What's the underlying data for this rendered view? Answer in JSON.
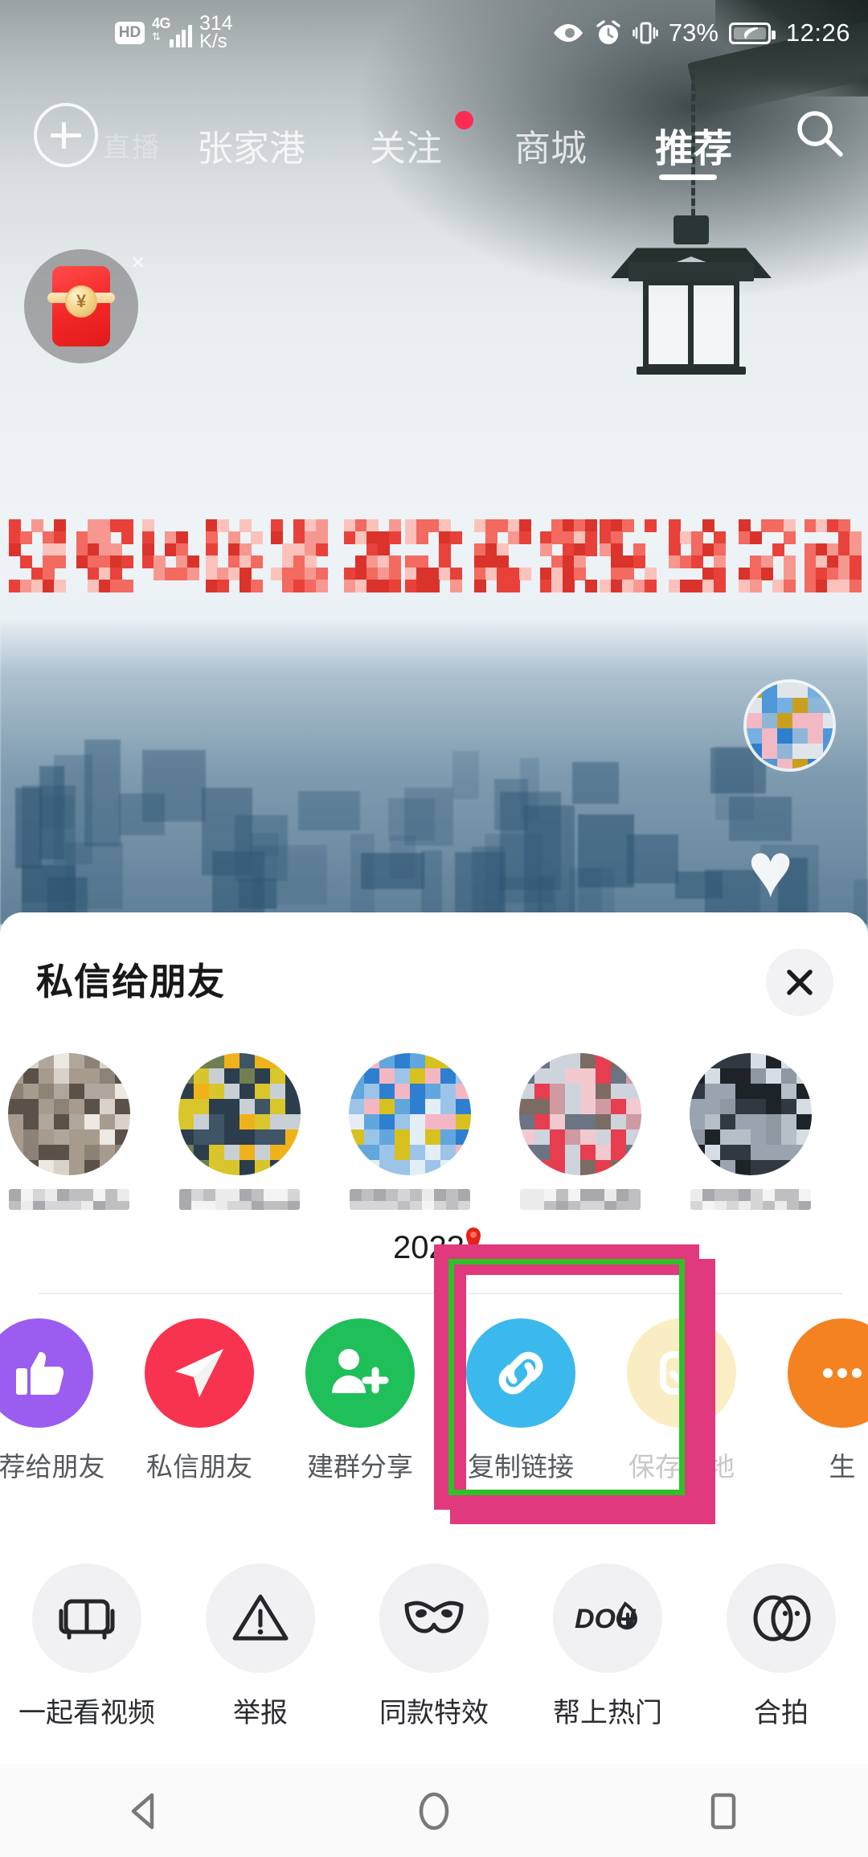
{
  "status_bar": {
    "hd": "HD",
    "network": "4G",
    "speed_value": "314",
    "speed_unit": "K/s",
    "battery_percent": "73%",
    "clock": "12:26",
    "icons": [
      "eye-icon",
      "alarm-clock-icon",
      "vibrate-icon",
      "battery-saver-icon"
    ]
  },
  "top_nav": {
    "add_button": "+",
    "ghost_label": "直播",
    "items": [
      {
        "label": "张家港",
        "active": false,
        "badge": false
      },
      {
        "label": "关注",
        "active": false,
        "badge": true
      },
      {
        "label": "商城",
        "active": false,
        "badge": false
      },
      {
        "label": "推荐",
        "active": true,
        "badge": false
      }
    ],
    "search_icon": "search-icon"
  },
  "floating_widget": {
    "name": "red-packet-widget",
    "coin_symbol": "¥",
    "close_label": "×"
  },
  "sheet": {
    "title": "私信给朋友",
    "close_label": "×",
    "friends": [
      {
        "name": "",
        "avatar_color": "#b0a79c"
      },
      {
        "name": "",
        "avatar_color": "#d9c52c"
      },
      {
        "name": "",
        "avatar_color": "#2f7fd0"
      },
      {
        "name": "",
        "avatar_color": "#cf9aa2"
      },
      {
        "name": "",
        "avatar_color": "#9aa3b0"
      }
    ],
    "actions_row1": [
      {
        "label": "推荐给朋友",
        "icon": "thumbs-up-icon",
        "color": "#9b5cf0",
        "faded": false
      },
      {
        "label": "私信朋友",
        "icon": "paper-plane-icon",
        "color": "#f8334f",
        "faded": false
      },
      {
        "label": "建群分享",
        "icon": "add-group-icon",
        "color": "#1fbf5a",
        "faded": false
      },
      {
        "label": "复制链接",
        "icon": "link-icon",
        "color": "#3cb9ec",
        "faded": false
      },
      {
        "label": "保存本地",
        "icon": "download-icon",
        "color": "#f5c948",
        "faded": true
      },
      {
        "label": "生",
        "icon": "more-icon",
        "color": "#f58220",
        "faded": false
      }
    ],
    "actions_row2": [
      {
        "label": "一起看视频",
        "icon": "sofa-icon"
      },
      {
        "label": "举报",
        "icon": "warning-triangle-icon"
      },
      {
        "label": "同款特效",
        "icon": "mask-icon"
      },
      {
        "label": "帮上热门",
        "icon": "dou-plus-icon"
      },
      {
        "label": "合拍",
        "icon": "duet-circles-icon"
      }
    ]
  },
  "annotation": {
    "note_text": "2023",
    "highlight_target": "复制链接",
    "outer_color": "#e0397e",
    "inner_color": "#2ec128"
  },
  "android_nav": {
    "back": "back-triangle-icon",
    "home": "home-circle-icon",
    "recents": "recents-square-icon"
  }
}
